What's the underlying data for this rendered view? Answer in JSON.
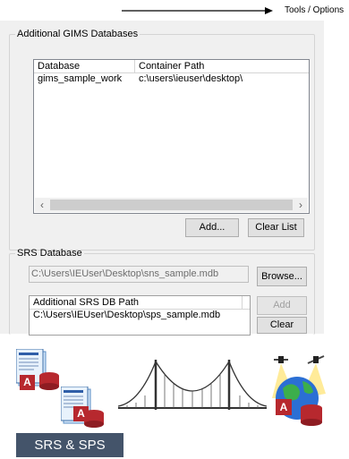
{
  "annotation": {
    "text": "Tools / Options"
  },
  "gims_group": {
    "legend": "Additional GIMS Databases",
    "columns": [
      "Database",
      "Container Path"
    ],
    "rows": [
      {
        "database": "gims_sample_work",
        "path": "c:\\users\\ieuser\\desktop\\"
      }
    ],
    "add_label": "Add...",
    "clear_list_label": "Clear List"
  },
  "srs_group": {
    "legend": "SRS Database",
    "path_value": "C:\\Users\\IEUser\\Desktop\\sns_sample.mdb",
    "browse_label": "Browse...",
    "additional_header": "Additional SRS DB Path",
    "additional_rows": [
      "C:\\Users\\IEUser\\Desktop\\sps_sample.mdb"
    ],
    "add_label": "Add",
    "clear_label": "Clear"
  },
  "illustration": {
    "badge_letter": "A",
    "caption": "SRS & SPS",
    "colors": {
      "access_red": "#b7282e",
      "caption_bg": "#44546a"
    }
  }
}
